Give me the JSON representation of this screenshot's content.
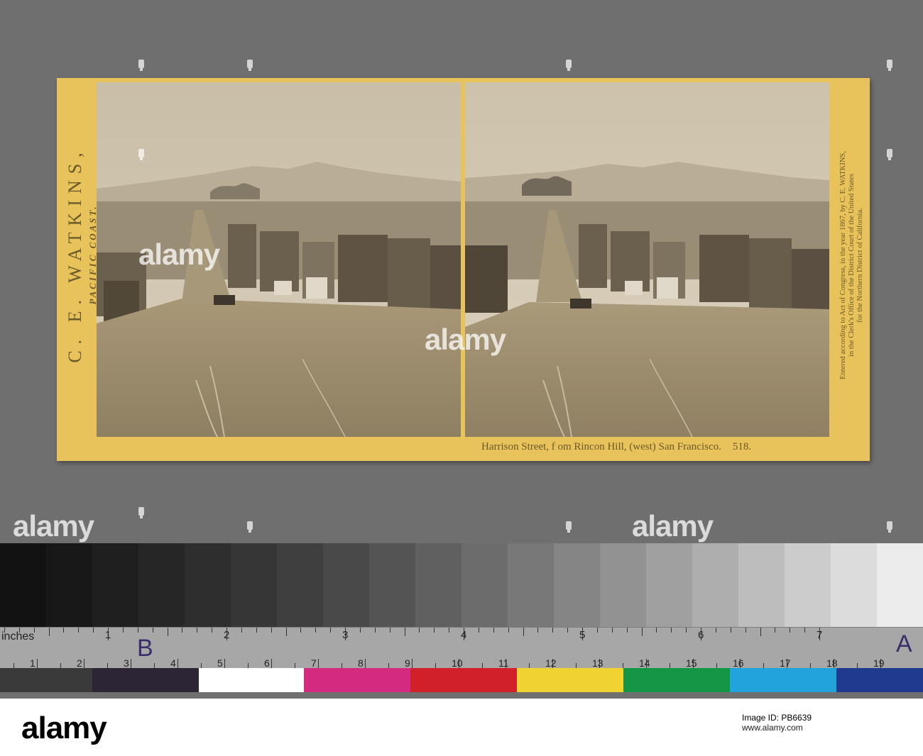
{
  "card": {
    "left_title": "C. E. WATKINS,",
    "left_subtitle": "PACIFIC COAST.",
    "right_copyright_lines": [
      "Entered according to Act of Congress, in the year 1867, by C. E. WATKINS,",
      "in the Clerk's Office of the District Court of the United States",
      "for the Northern District of California."
    ],
    "caption": "Harrison Street, f om Rincon Hill, (west) San Francisco.",
    "number": "518."
  },
  "watermarks": [
    "alamy",
    "alamy",
    "alamy",
    "alamy"
  ],
  "ruler": {
    "unit_label": "inches",
    "inch_ticks": [
      "1",
      "2",
      "3",
      "4",
      "5",
      "6",
      "7"
    ],
    "cm_ticks": [
      "1",
      "2",
      "3",
      "4",
      "5",
      "6",
      "7",
      "8",
      "9",
      "10",
      "11",
      "12",
      "13",
      "14",
      "15",
      "16",
      "17",
      "18",
      "19"
    ],
    "hand_left": "B",
    "hand_right": "A"
  },
  "grey_steps": [
    "#121212",
    "#181818",
    "#1f1f1f",
    "#262626",
    "#2e2e2e",
    "#363636",
    "#3f3f3f",
    "#494949",
    "#545454",
    "#606060",
    "#6c6c6c",
    "#787878",
    "#858585",
    "#929292",
    "#a0a0a0",
    "#aeaeae",
    "#bdbdbd",
    "#cccccc",
    "#dcdcdc",
    "#ececec"
  ],
  "color_patches": [
    "#3a3a3a",
    "#2b2536",
    "#ffffff",
    "#d42a80",
    "#d2202a",
    "#f0d230",
    "#159646",
    "#22a3dc",
    "#1f3a8e"
  ],
  "alamy_bar": {
    "logo": "alamy",
    "id_label": "Image ID: PB6639",
    "url": "www.alamy.com",
    "id": "PB6639"
  }
}
